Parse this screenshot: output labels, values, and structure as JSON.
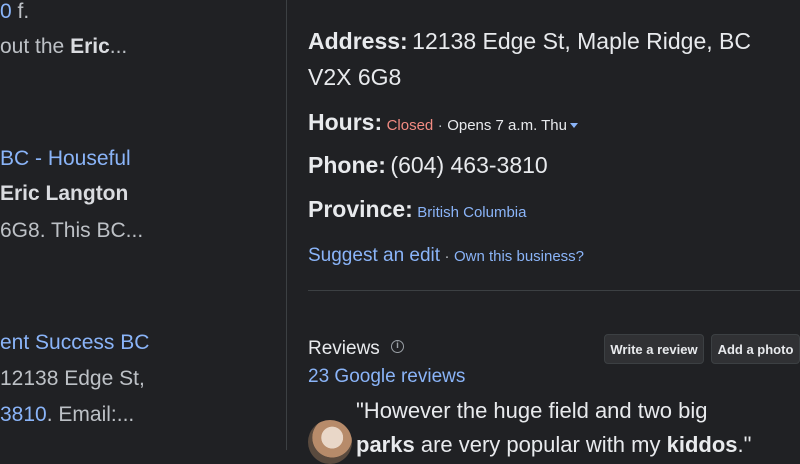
{
  "left_snippets": [
    {
      "prefix": "0",
      "rest": " f."
    },
    {
      "text_before": "out the ",
      "bold": "Eric",
      "after": "..."
    },
    {
      "link": "BC - Houseful"
    },
    {
      "bold": "Eric Langton"
    },
    {
      "text": "6G8. This BC",
      "after": "..."
    },
    {
      "link": "ent Success BC"
    },
    {
      "text": "12138 Edge St,"
    },
    {
      "link": "3810",
      "text": ". Email:",
      "after": "..."
    }
  ],
  "business": {
    "address_label": "Address:",
    "address_line1": "12138 Edge St, Maple Ridge, BC",
    "address_line2": "V2X 6G8",
    "hours_label": "Hours:",
    "hours_status": "Closed",
    "hours_sep": "·",
    "hours_next": "Opens 7 a.m. Thu",
    "phone_label": "Phone:",
    "phone": "(604) 463-3810",
    "province_label": "Province:",
    "province": "British Columbia",
    "suggest_edit": "Suggest an edit",
    "sep": "·",
    "own_business": "Own this business?"
  },
  "reviews": {
    "title": "Reviews",
    "write_review": "Write a review",
    "add_photo": "Add a photo",
    "count_link": "23 Google reviews",
    "quote_line1": "\"However the huge field and two big",
    "quote_bold1": "parks",
    "quote_mid": " are very popular with my ",
    "quote_bold2": "kiddos",
    "quote_end": ".\""
  },
  "icons": {
    "info": "info-icon",
    "caret": "caret-down-icon"
  },
  "colors": {
    "background": "#202124",
    "link": "#8ab4f8",
    "closed": "#f28b82"
  }
}
